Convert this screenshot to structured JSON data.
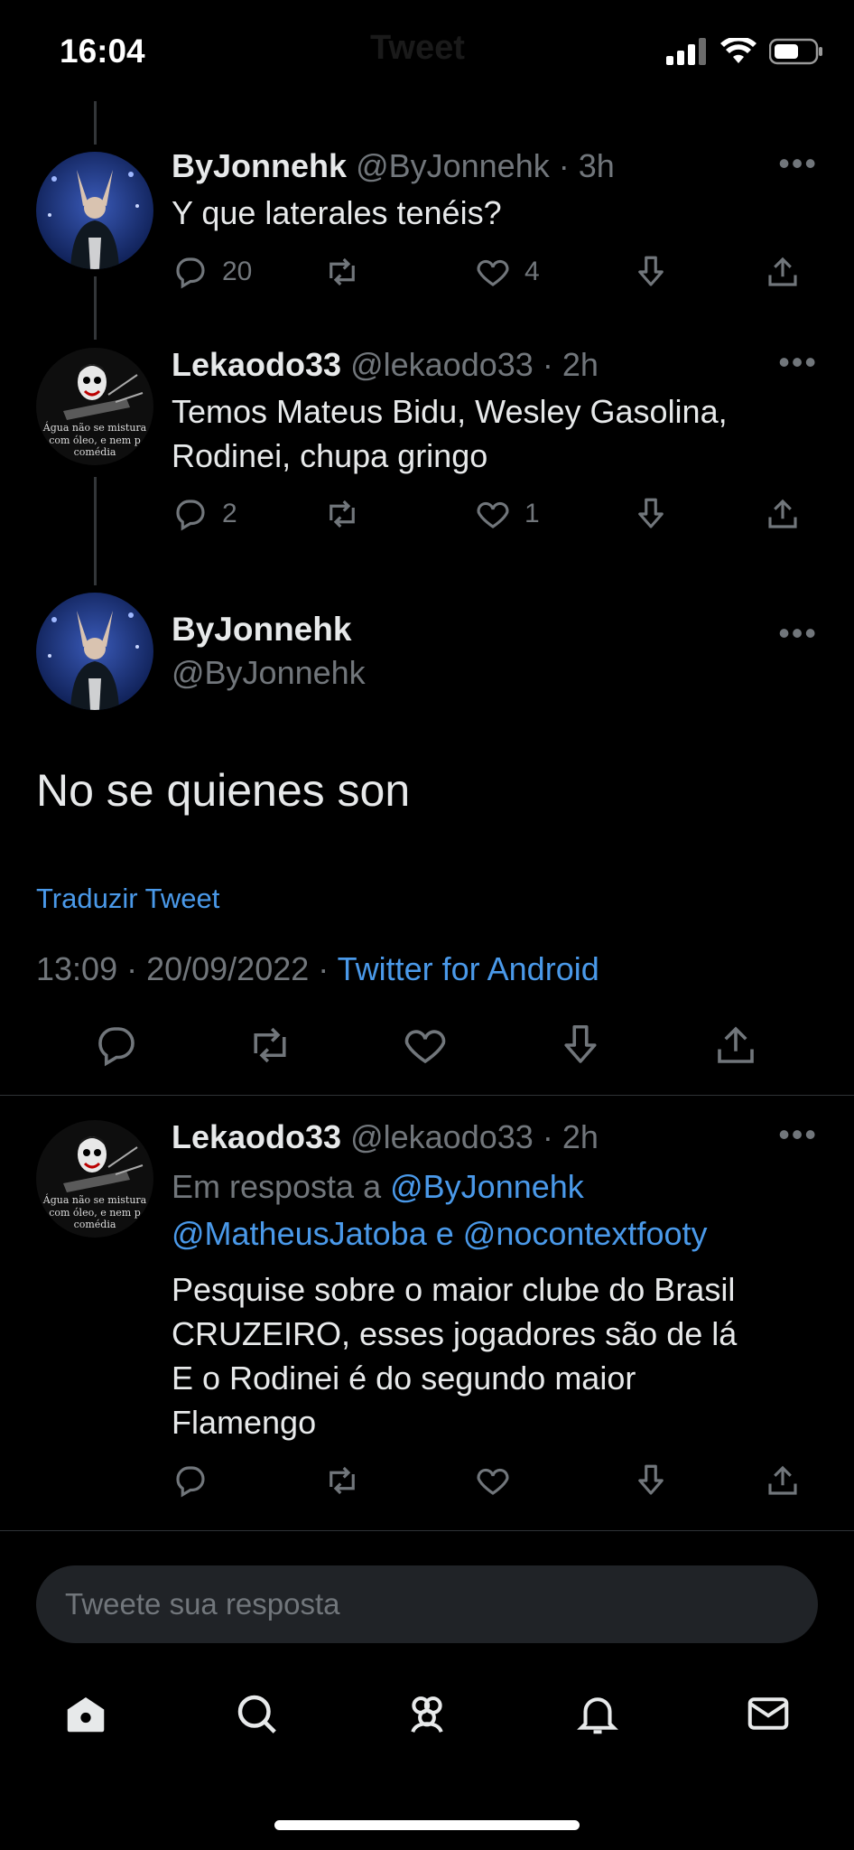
{
  "status_bar": {
    "time": "16:04"
  },
  "header": {
    "title": "Tweet"
  },
  "tweets": [
    {
      "name": "ByJonnehk",
      "handle": "@ByJonnehk",
      "sep": "·",
      "time": "3h",
      "text": "Y que laterales tenéis?",
      "replies": "20",
      "retweets": "",
      "likes": "4"
    },
    {
      "name": "Lekaodo33",
      "handle": "@lekaodo33",
      "sep": "·",
      "time": "2h",
      "text_lines": [
        "Temos Mateus Bidu, Wesley Gasolina,",
        "Rodinei, chupa gringo"
      ],
      "replies": "2",
      "retweets": "",
      "likes": "1"
    }
  ],
  "main_tweet": {
    "name": "ByJonnehk",
    "handle": "@ByJonnehk",
    "text": "No se quienes son",
    "translate": "Traduzir Tweet",
    "timestamp": "13:09 · 20/09/2022 ·",
    "source": "Twitter for Android"
  },
  "reply_tweet": {
    "name": "Lekaodo33",
    "handle": "@lekaodo33",
    "sep": "·",
    "time": "2h",
    "in_reply_to_label": "Em resposta a",
    "mention_1": "@ByJonnehk",
    "mention_2": "@MatheusJatoba",
    "conj": "e",
    "mention_3": "@nocontextfooty",
    "text_lines": [
      "Pesquise sobre o maior clube do Brasil",
      "CRUZEIRO, esses jogadores são de lá",
      "E o Rodinei é do segundo maior",
      "Flamengo"
    ]
  },
  "avatar_caption_lines": [
    "Água não se mistura",
    "com óleo, e nem p",
    "comédia"
  ],
  "compose": {
    "placeholder": "Tweete sua resposta"
  },
  "tab_icons": [
    "home-icon",
    "search-icon",
    "communities-icon",
    "notifications-icon",
    "messages-icon"
  ],
  "colors": {
    "background": "#000000",
    "link": "#4a99e9",
    "muted": "#71767b",
    "text": "#e7e9ea"
  }
}
